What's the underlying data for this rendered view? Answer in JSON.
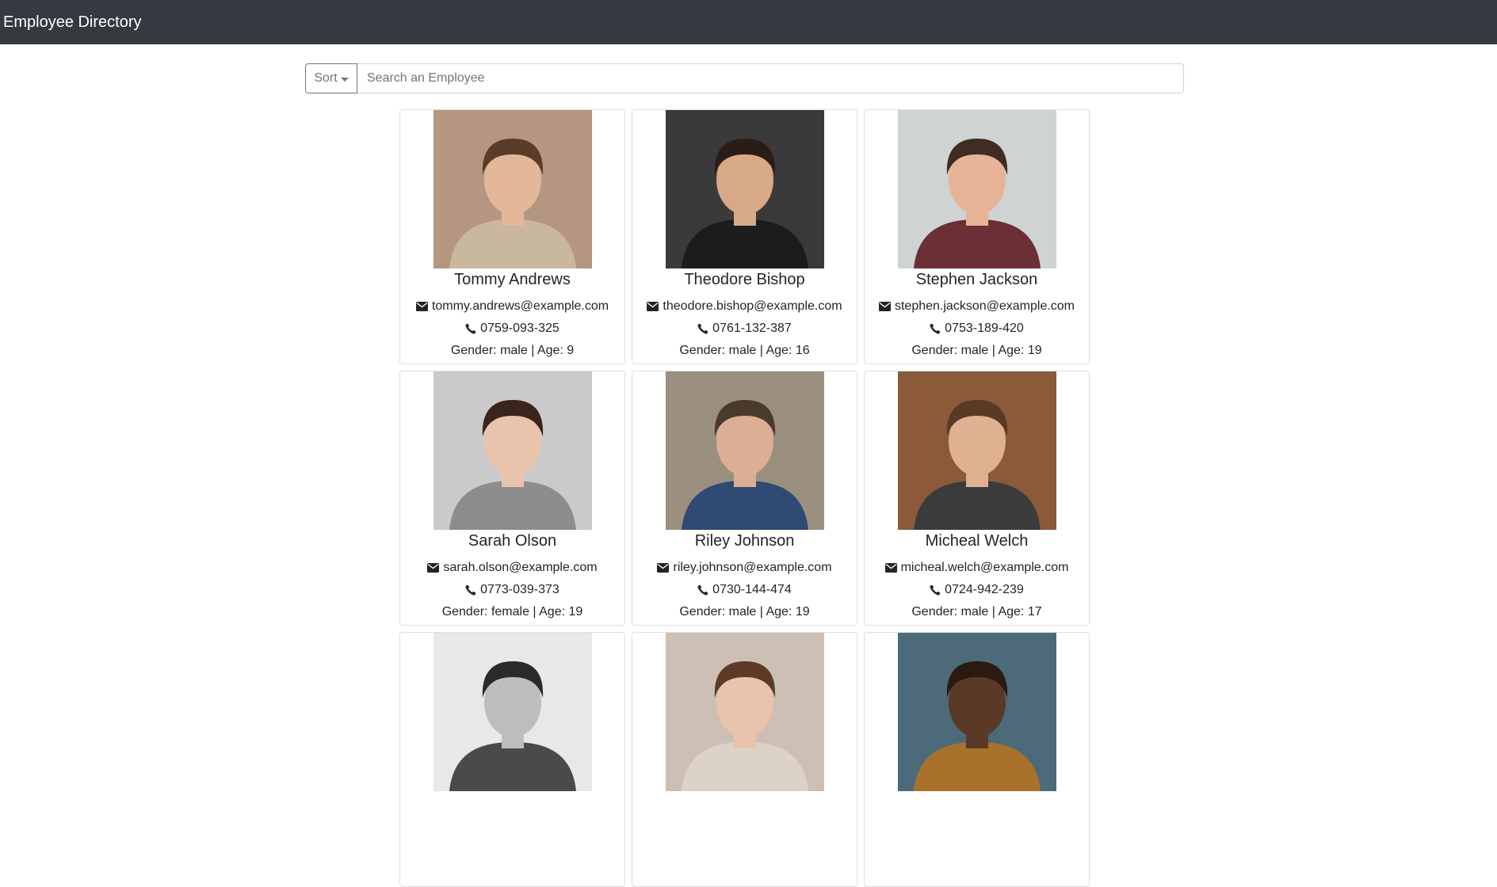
{
  "app": {
    "title": "Employee Directory"
  },
  "search": {
    "sort_label": "Sort",
    "placeholder": "Search an Employee",
    "value": ""
  },
  "employees": [
    {
      "name": "Tommy Andrews",
      "email": "tommy.andrews@example.com",
      "phone": "0759-093-325",
      "meta": "Gender: male | Age: 9",
      "bg": "#b59680",
      "skin": "#e3b89a",
      "hair": "#5a3c2b",
      "shirt": "#c9b7a0"
    },
    {
      "name": "Theodore Bishop",
      "email": "theodore.bishop@example.com",
      "phone": "0761-132-387",
      "meta": "Gender: male | Age: 16",
      "bg": "#3a3a3a",
      "skin": "#d8a987",
      "hair": "#2b1d15",
      "shirt": "#1c1c1c"
    },
    {
      "name": "Stephen Jackson",
      "email": "stephen.jackson@example.com",
      "phone": "0753-189-420",
      "meta": "Gender: male | Age: 19",
      "bg": "#cfd3d4",
      "skin": "#e8b497",
      "hair": "#3f2c22",
      "shirt": "#6b2f35"
    },
    {
      "name": "Sarah Olson",
      "email": "sarah.olson@example.com",
      "phone": "0773-039-373",
      "meta": "Gender: female | Age: 19",
      "bg": "#cacaca",
      "skin": "#eac3ad",
      "hair": "#3a241b",
      "shirt": "#8d8d8d"
    },
    {
      "name": "Riley Johnson",
      "email": "riley.johnson@example.com",
      "phone": "0730-144-474",
      "meta": "Gender: male | Age: 19",
      "bg": "#9b8f80",
      "skin": "#dcae93",
      "hair": "#4a3a2e",
      "shirt": "#2f4a73"
    },
    {
      "name": "Micheal Welch",
      "email": "micheal.welch@example.com",
      "phone": "0724-942-239",
      "meta": "Gender: male | Age: 17",
      "bg": "#8a5a3b",
      "skin": "#e0b191",
      "hair": "#5a3a24",
      "shirt": "#3b3b3b"
    },
    {
      "name": "",
      "email": "",
      "phone": "",
      "meta": "",
      "bg": "#e8e8e8",
      "skin": "#bdbdbd",
      "hair": "#2a2a2a",
      "shirt": "#4a4a4a"
    },
    {
      "name": "",
      "email": "",
      "phone": "",
      "meta": "",
      "bg": "#cdbfb3",
      "skin": "#e9c3ab",
      "hair": "#5b3b28",
      "shirt": "#dcd2c8"
    },
    {
      "name": "",
      "email": "",
      "phone": "",
      "meta": "",
      "bg": "#4d6a7a",
      "skin": "#5a3a26",
      "hair": "#2a1a12",
      "shirt": "#a8722c"
    }
  ]
}
